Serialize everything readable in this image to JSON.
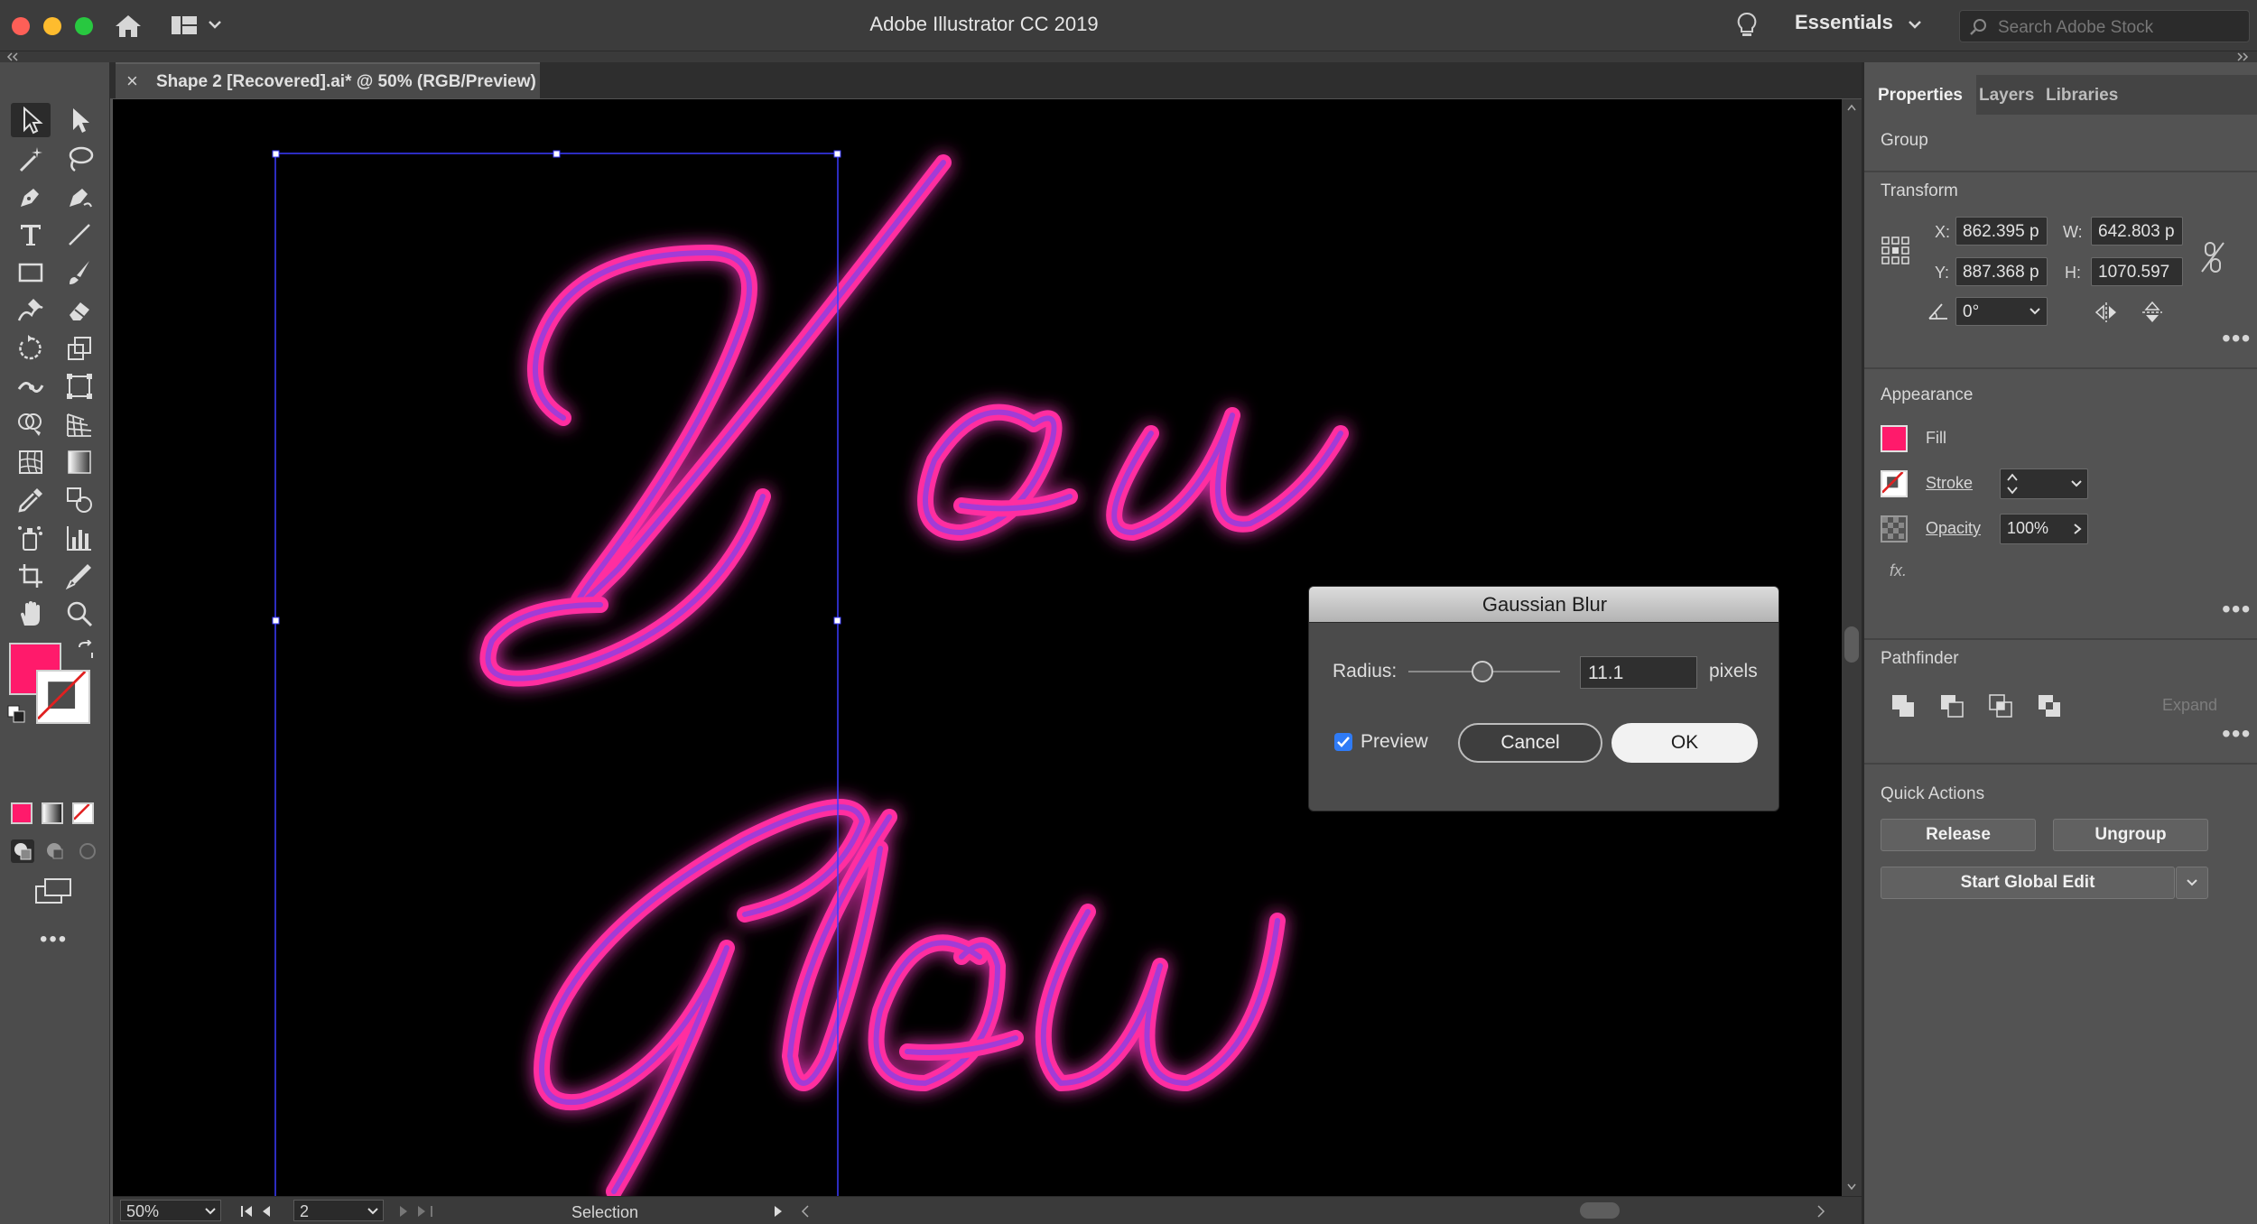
{
  "window": {
    "title": "Adobe Illustrator CC 2019"
  },
  "header": {
    "workspace": "Essentials",
    "search_placeholder": "Search Adobe Stock"
  },
  "document": {
    "tab_title": "Shape 2 [Recovered].ai* @ 50% (RGB/Preview)"
  },
  "artwork": {
    "line1": "You",
    "line2": "Glow",
    "glow_color": "#ff2fa0",
    "core_color": "#a33bd6"
  },
  "status": {
    "zoom": "50%",
    "artboard": "2",
    "tool": "Selection"
  },
  "panel": {
    "tabs": [
      "Properties",
      "Layers",
      "Libraries"
    ],
    "object_type": "Group",
    "transform": {
      "title": "Transform",
      "x_label": "X:",
      "x": "862.395 p",
      "y_label": "Y:",
      "y": "887.368 p",
      "w_label": "W:",
      "w": "642.803 p",
      "h_label": "H:",
      "h": "1070.597",
      "angle": "0°"
    },
    "appearance": {
      "title": "Appearance",
      "fill_label": "Fill",
      "fill_color": "#ff1a6b",
      "stroke_label": "Stroke",
      "opacity_label": "Opacity",
      "opacity": "100%",
      "fx": "fx."
    },
    "pathfinder": {
      "title": "Pathfinder",
      "expand": "Expand"
    },
    "quick_actions": {
      "title": "Quick Actions",
      "release": "Release",
      "ungroup": "Ungroup",
      "global_edit": "Start Global Edit"
    }
  },
  "dialog": {
    "title": "Gaussian Blur",
    "radius_label": "Radius:",
    "radius_value": "11.1",
    "units": "pixels",
    "preview_label": "Preview",
    "cancel": "Cancel",
    "ok": "OK"
  }
}
